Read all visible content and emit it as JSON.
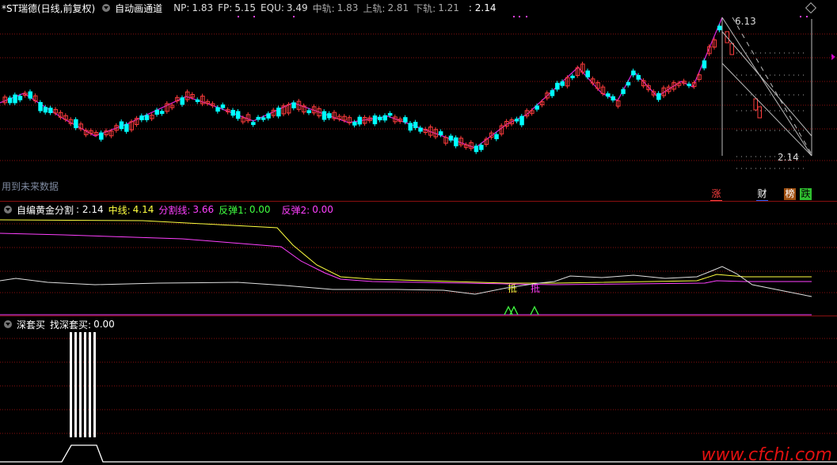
{
  "main_panel": {
    "stock_name": "*ST瑞德",
    "period_label": "(日线,前复权)",
    "indicator_name": "自动画通道",
    "np_label": "NP:",
    "np_value": "1.83",
    "fp_label": "FP:",
    "fp_value": "5.15",
    "equ_label": "EQU:",
    "equ_value": "3.49",
    "mid_label": "中轨:",
    "mid_value": "1.83",
    "upper_label": "上轨:",
    "upper_value": "2.81",
    "lower_label": "下轨:",
    "lower_value": "1.21",
    "extra_value": ": 2.14",
    "high_marker": "6.13",
    "low_marker": "2.14",
    "future_data_note": "用到未来数据",
    "badges": [
      "涨",
      "财",
      "榜",
      "跌"
    ],
    "badge_colors": [
      "#c01818",
      "#2060d0",
      "#d08020",
      "#20a020"
    ]
  },
  "gold_panel": {
    "title": "自编黄金分割",
    "value1_label": ": 2.14",
    "mid_label": "中线:",
    "mid_value": "4.14",
    "split_label": "分割线:",
    "split_value": "3.66",
    "rebound1_label": "反弹1:",
    "rebound1_value": "0.00",
    "rebound2_label": "反弹2:",
    "rebound2_value": "0.00",
    "low_tag": "抵"
  },
  "deep_panel": {
    "title": "深套买",
    "find_label": "找深套买:",
    "find_value": "0.00"
  },
  "watermark": "www.cfchi.com",
  "colors": {
    "up": "#ff3c3c",
    "down": "#00ffff",
    "zigzag": "#d020d0",
    "yellow": "#ffff40",
    "magenta": "#ff40ff",
    "white": "#e0e0e0",
    "grid": "#8a1010"
  }
}
